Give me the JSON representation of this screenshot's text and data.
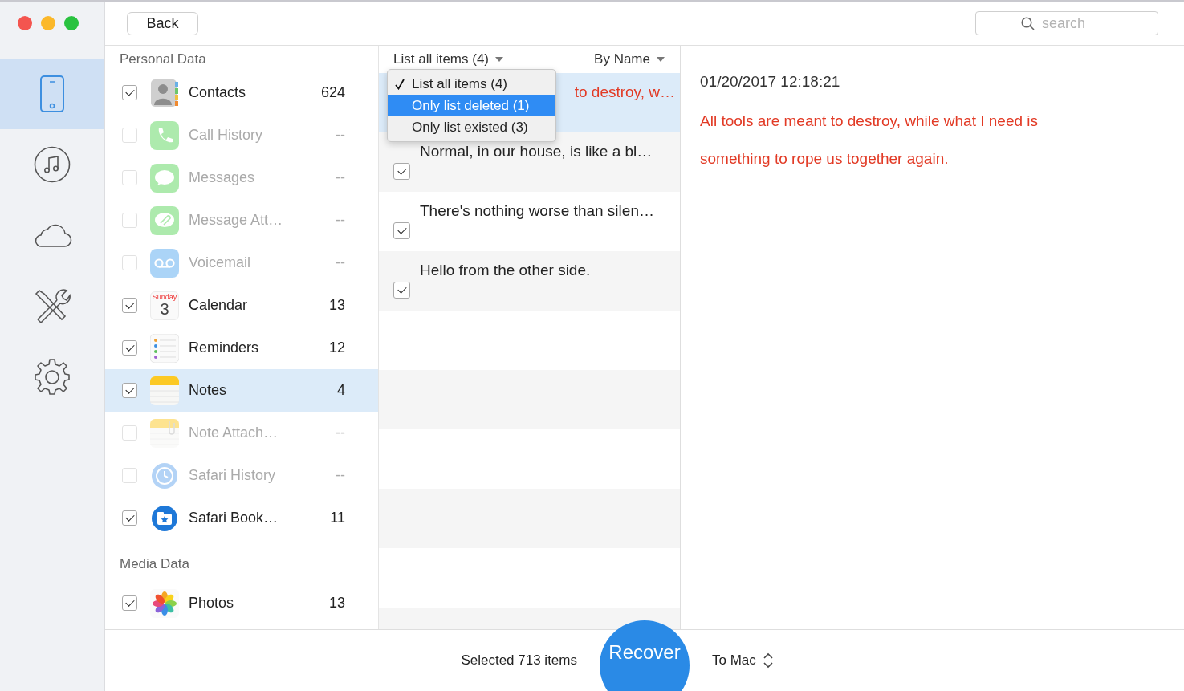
{
  "nav": [
    {
      "selected": true
    },
    {
      "selected": false
    },
    {
      "selected": false
    },
    {
      "selected": false
    },
    {
      "selected": false
    }
  ],
  "toolbar": {
    "back_button": "Back",
    "search": {
      "placeholder": "search"
    }
  },
  "categories": [
    {
      "title": "Personal Data",
      "items": [
        {
          "name": "Contacts",
          "count": "624",
          "checked": true,
          "disabled": false,
          "selected": false
        },
        {
          "name": "Call History",
          "count": "--",
          "checked": false,
          "disabled": true,
          "selected": false
        },
        {
          "name": "Messages",
          "count": "--",
          "checked": false,
          "disabled": true,
          "selected": false
        },
        {
          "name": "Message Att…",
          "count": "--",
          "checked": false,
          "disabled": true,
          "selected": false
        },
        {
          "name": "Voicemail",
          "count": "--",
          "checked": false,
          "disabled": true,
          "selected": false
        },
        {
          "name": "Calendar",
          "count": "13",
          "checked": true,
          "disabled": false,
          "selected": false,
          "icon_caption": "Sunday",
          "icon_label": "3"
        },
        {
          "name": "Reminders",
          "count": "12",
          "checked": true,
          "disabled": false,
          "selected": false
        },
        {
          "name": "Notes",
          "count": "4",
          "checked": true,
          "disabled": false,
          "selected": true
        },
        {
          "name": "Note Attach…",
          "count": "--",
          "checked": false,
          "disabled": true,
          "selected": false
        },
        {
          "name": "Safari History",
          "count": "--",
          "checked": false,
          "disabled": true,
          "selected": false
        },
        {
          "name": "Safari Book…",
          "count": "11",
          "checked": true,
          "disabled": false,
          "selected": false
        }
      ]
    },
    {
      "title": "Media Data",
      "items": [
        {
          "name": "Photos",
          "count": "13",
          "checked": true,
          "disabled": false,
          "selected": false
        }
      ]
    }
  ],
  "notes_list": {
    "filter": "List all items (4)",
    "sort": "By Name",
    "rows": [
      {
        "kind": "deleted",
        "text": "to destroy, w…",
        "selected": true
      },
      {
        "kind": "existed",
        "text": "Normal, in our house, is like a bl…",
        "checked": true,
        "selected": false
      },
      {
        "kind": "existed",
        "text": "There's nothing worse than silen…",
        "checked": true,
        "selected": false
      },
      {
        "kind": "existed",
        "text": "Hello from the other side.",
        "checked": true,
        "selected": false
      }
    ]
  },
  "filter_menu": {
    "items": [
      {
        "label": "List all items (4)",
        "checked": true,
        "highlighted": false
      },
      {
        "label": "Only list deleted (1)",
        "checked": false,
        "highlighted": true
      },
      {
        "label": "Only list existed (3)",
        "checked": false,
        "highlighted": false
      }
    ]
  },
  "detail": {
    "timestamp": "01/20/2017 12:18:21",
    "kind": "deleted",
    "text": "All tools are meant to destroy, while what I need is something to rope us together again."
  },
  "footer": {
    "selection": "Selected 713 items",
    "recover_button": "Recover",
    "destination": "To Mac"
  }
}
